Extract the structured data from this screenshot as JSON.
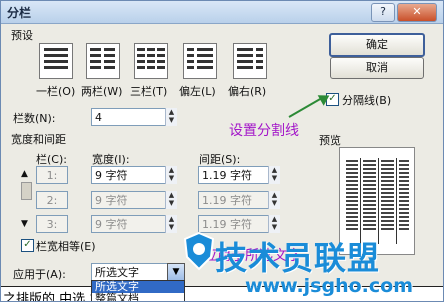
{
  "window": {
    "title": "分栏",
    "help": "?",
    "close": "✕"
  },
  "presets": {
    "group_label": "预设",
    "items": [
      {
        "label": "一栏(O)"
      },
      {
        "label": "两栏(W)"
      },
      {
        "label": "三栏(T)"
      },
      {
        "label": "偏左(L)"
      },
      {
        "label": "偏右(R)"
      }
    ]
  },
  "buttons": {
    "ok": "确定",
    "cancel": "取消"
  },
  "column_count": {
    "label": "栏数(N):",
    "value": "4"
  },
  "divider": {
    "label": "分隔线(B)",
    "checked": true
  },
  "width_spacing": {
    "group_label": "宽度和间距",
    "col_header": "栏(C):",
    "width_header": "宽度(I):",
    "spacing_header": "间距(S):",
    "rows": [
      {
        "num": "1:",
        "width": "9 字符",
        "spacing": "1.19 字符"
      },
      {
        "num": "2:",
        "width": "9 字符",
        "spacing": "1.19 字符"
      },
      {
        "num": "3:",
        "width": "9 字符",
        "spacing": "1.19 字符"
      }
    ]
  },
  "preview_label": "预览",
  "equal_width": {
    "label": "栏宽相等(E)",
    "checked": true
  },
  "apply_to": {
    "label": "应用于(A):",
    "value": "所选文字",
    "options": [
      "所选文字",
      "整篇文档"
    ]
  },
  "annotations": {
    "divider_note": "设置分割线",
    "apply_note": "应用于所选文字"
  },
  "background_text": "之排版的  中选  之",
  "watermark": {
    "title": "技术员联盟",
    "url": "www.jsgho.com"
  }
}
